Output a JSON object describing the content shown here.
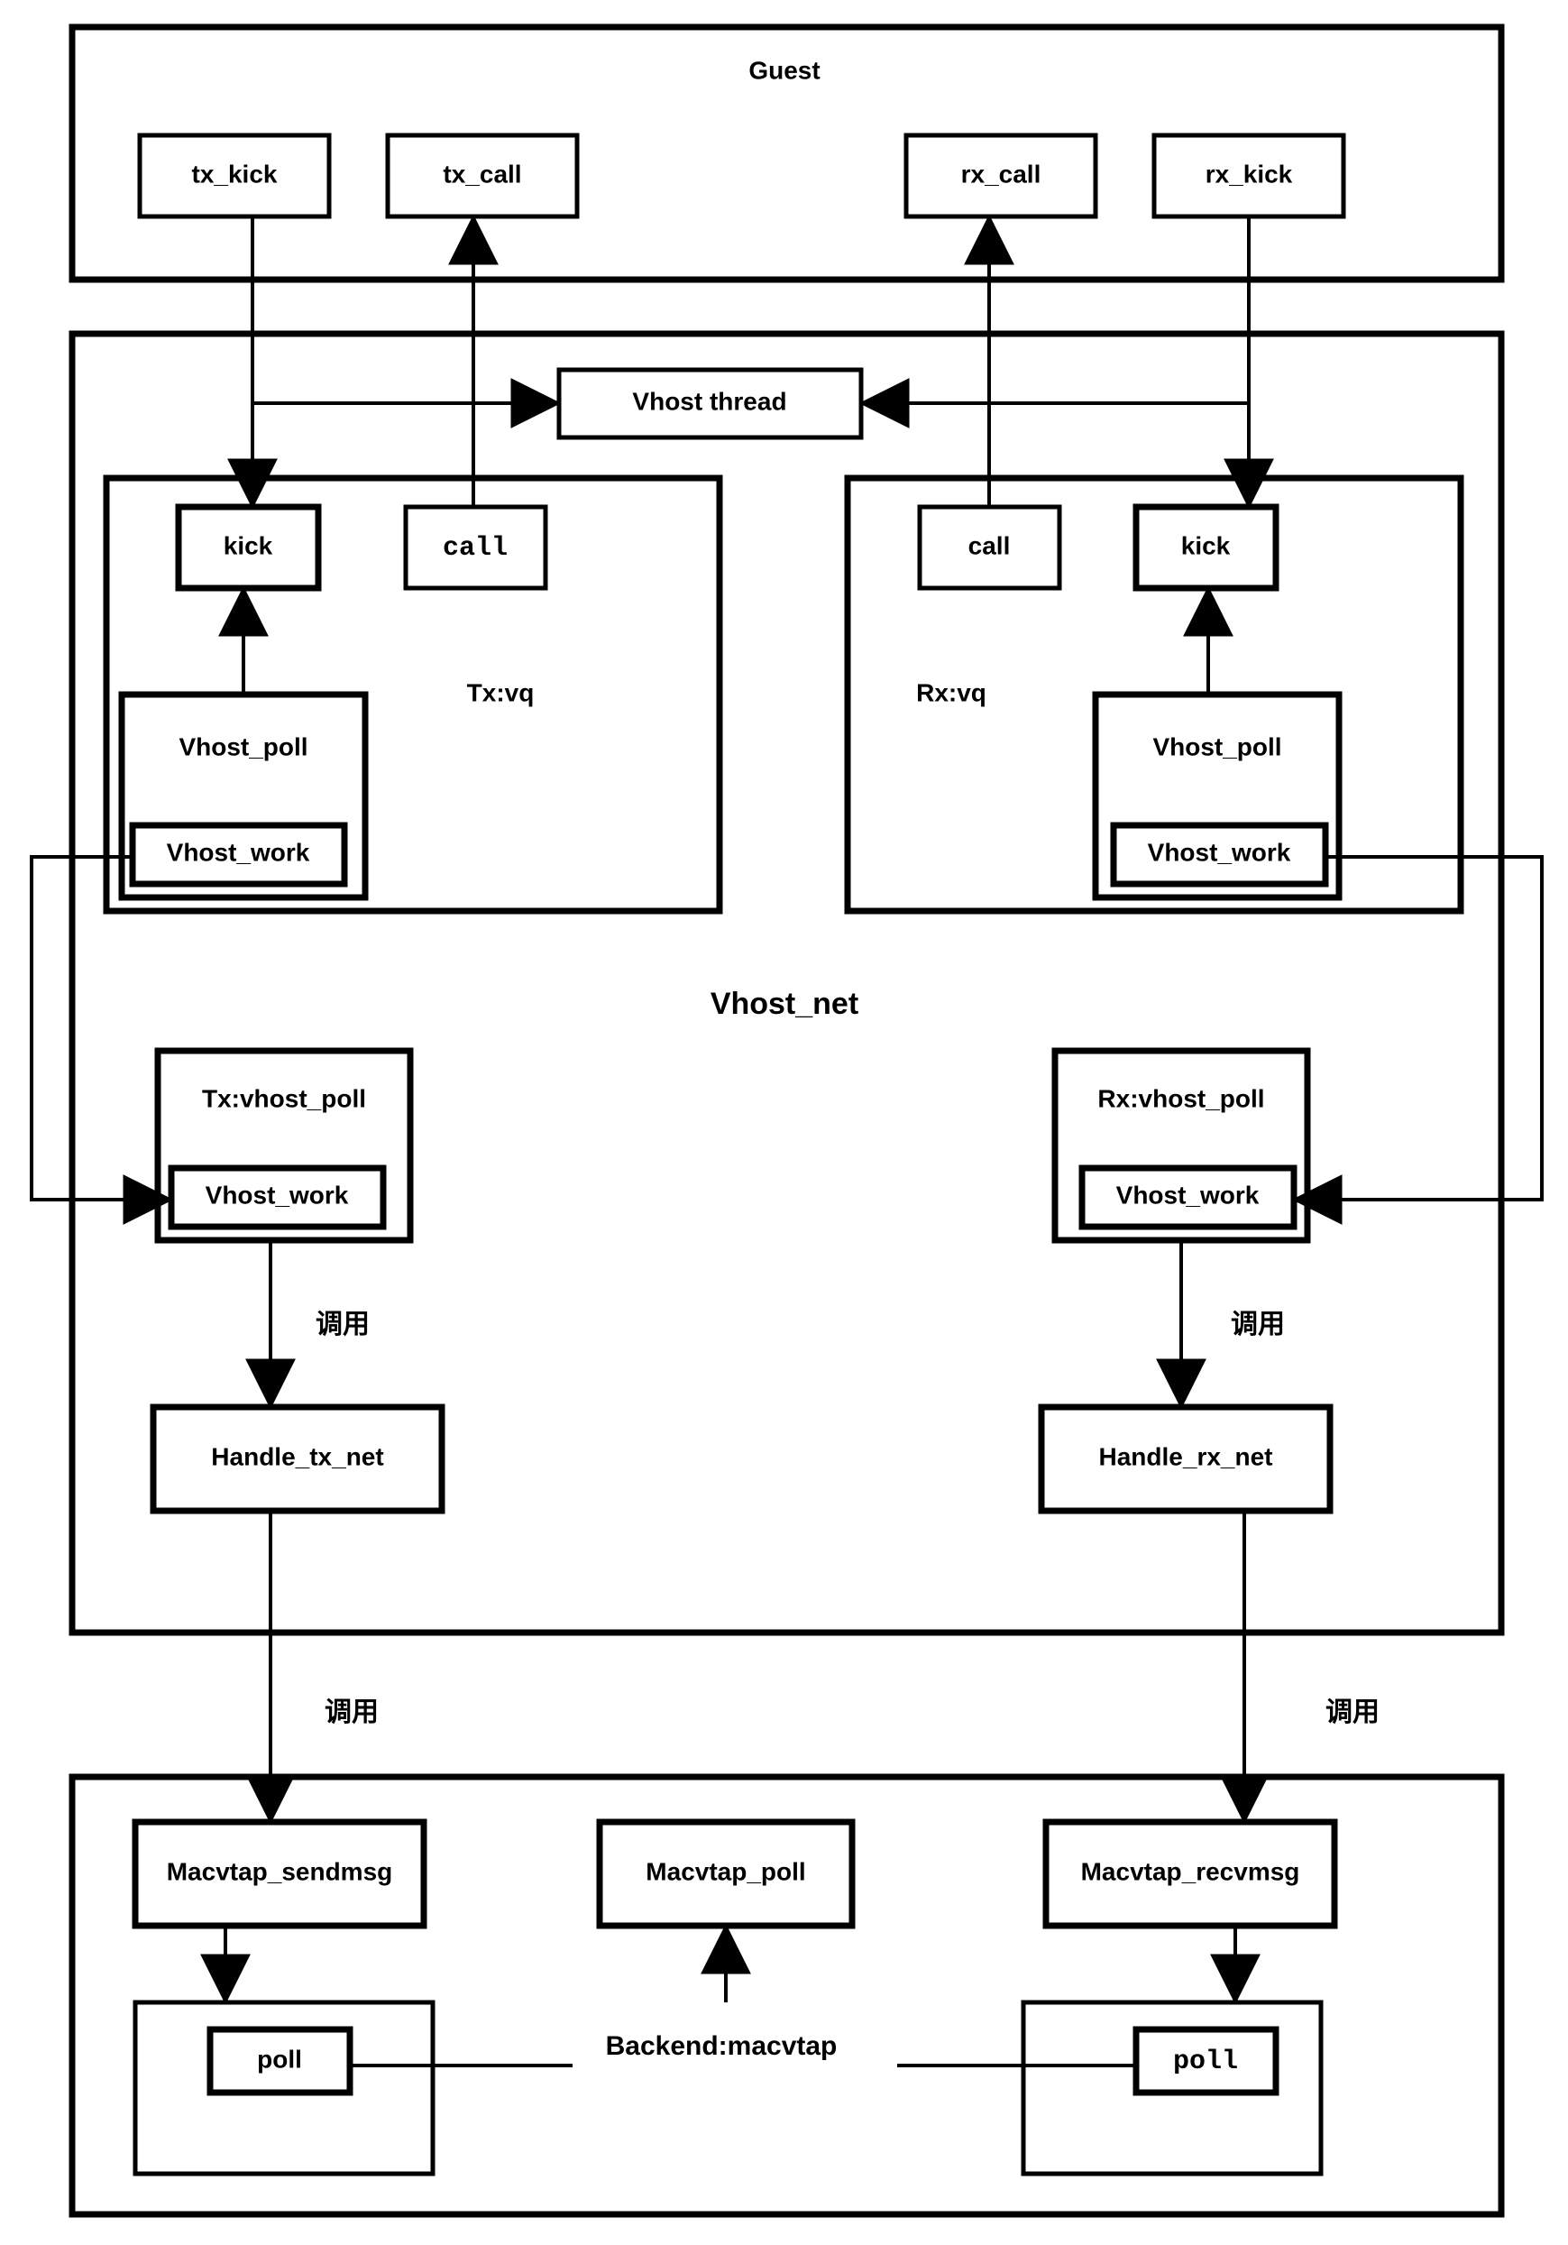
{
  "guest": {
    "title": "Guest",
    "tx_kick": "tx_kick",
    "tx_call": "tx_call",
    "rx_call": "rx_call",
    "rx_kick": "rx_kick"
  },
  "vhost_net": {
    "title": "Vhost_net",
    "thread": "Vhost thread",
    "tx_vq": {
      "label": "Tx:vq",
      "kick": "kick",
      "call": "call",
      "poll": "Vhost_poll",
      "work": "Vhost_work"
    },
    "rx_vq": {
      "label": "Rx:vq",
      "kick": "kick",
      "call": "call",
      "poll": "Vhost_poll",
      "work": "Vhost_work"
    },
    "tx_poll": {
      "label": "Tx:vhost_poll",
      "work": "Vhost_work"
    },
    "rx_poll": {
      "label": "Rx:vhost_poll",
      "work": "Vhost_work"
    },
    "handle_tx": "Handle_tx_net",
    "handle_rx": "Handle_rx_net",
    "call_tx": "调用",
    "call_rx": "调用"
  },
  "backend": {
    "title": "Backend:macvtap",
    "sendmsg": "Macvtap_sendmsg",
    "poll": "Macvtap_poll",
    "recvmsg": "Macvtap_recvmsg",
    "poll_l": "poll",
    "poll_r": "poll",
    "call_tx": "调用",
    "call_rx": "调用"
  }
}
